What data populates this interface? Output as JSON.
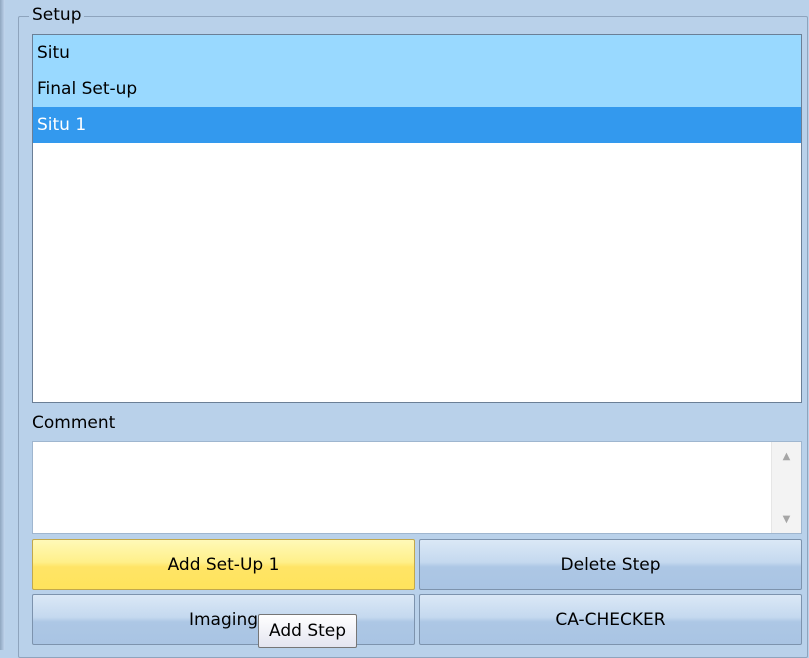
{
  "setup_group": {
    "title": "Setup"
  },
  "setup_list": {
    "items": [
      {
        "label": "Situ",
        "state": "highlighted"
      },
      {
        "label": "Final Set-up",
        "state": "highlighted"
      },
      {
        "label": "Situ 1",
        "state": "selected"
      }
    ]
  },
  "comment": {
    "label": "Comment",
    "value": ""
  },
  "buttons": {
    "add_setup": "Add Set-Up 1",
    "delete_step": "Delete Step",
    "imaging": "Imaging",
    "ca_checker": "CA-CHECKER"
  },
  "tooltip": {
    "text": "Add Step"
  },
  "colors": {
    "panel_background": "#b9d1ea",
    "list_highlight": "#99d9ff",
    "list_selected": "#3399ee",
    "button_hover": "#ffe466"
  }
}
